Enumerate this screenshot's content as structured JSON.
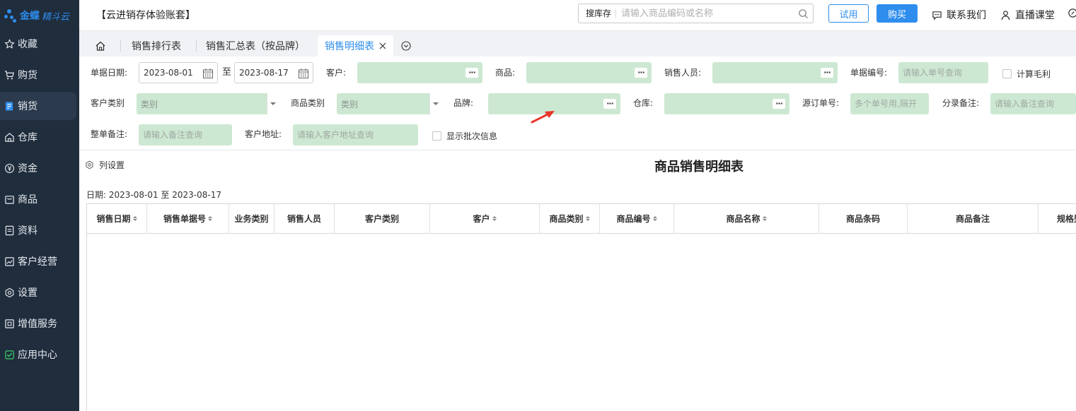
{
  "sidebar": {
    "logo_brand": "金蝶",
    "logo_sub": "精斗云",
    "items": [
      {
        "label": "收藏",
        "icon": "star-icon"
      },
      {
        "label": "购货",
        "icon": "cart-icon"
      },
      {
        "label": "销货",
        "icon": "sales-doc-icon"
      },
      {
        "label": "仓库",
        "icon": "warehouse-icon"
      },
      {
        "label": "资金",
        "icon": "yen-icon"
      },
      {
        "label": "商品",
        "icon": "product-icon"
      },
      {
        "label": "资料",
        "icon": "file-icon"
      },
      {
        "label": "客户经营",
        "icon": "chart-icon"
      },
      {
        "label": "设置",
        "icon": "settings-icon"
      },
      {
        "label": "增值服务",
        "icon": "service-icon"
      },
      {
        "label": "应用中心",
        "icon": "app-check-icon"
      }
    ],
    "active_index": 2
  },
  "header": {
    "account": "【云进销存体验账套】",
    "search_scope": "搜库存",
    "search_placeholder": "请输入商品编码或名称",
    "trial_label": "试用",
    "buy_label": "购买",
    "contact_label": "联系我们",
    "live_label": "直播课堂"
  },
  "tabs": {
    "items": [
      "销售排行表",
      "销售汇总表（按品牌）",
      "销售明细表"
    ],
    "active_index": 2
  },
  "filters": {
    "doc_date_label": "单据日期:",
    "date_from": "2023-08-01",
    "date_to_sep": "至",
    "date_to": "2023-08-17",
    "customer_label": "客户:",
    "product_label": "商品:",
    "salesperson_label": "销售人员:",
    "doc_no_label": "单据编号:",
    "doc_no_placeholder": "请输入单号查询",
    "gross_profit_label": "计算毛利",
    "customer_cat_label": "客户类别",
    "customer_cat_value": "类别",
    "product_cat_label": "商品类别",
    "product_cat_value": "类别",
    "brand_label": "品牌:",
    "warehouse_label": "仓库:",
    "source_order_label": "源订单号:",
    "source_order_placeholder": "多个单号用,隔开",
    "entry_note_label": "分录备注:",
    "entry_note_placeholder": "请输入备注查询",
    "whole_note_label": "整单备注:",
    "whole_note_placeholder": "请输入备注查询",
    "address_label": "客户地址:",
    "address_placeholder": "请输入客户地址查询",
    "batch_label": "显示批次信息"
  },
  "report": {
    "column_settings": "列设置",
    "title": "商品销售明细表",
    "date_range": "日期: 2023-08-01 至 2023-08-17",
    "columns": [
      {
        "label": "销售日期",
        "sortable": true
      },
      {
        "label": "销售单据号",
        "sortable": true
      },
      {
        "label": "业务类别",
        "sortable": false
      },
      {
        "label": "销售人员",
        "sortable": false
      },
      {
        "label": "客户类别",
        "sortable": false
      },
      {
        "label": "客户",
        "sortable": true
      },
      {
        "label": "商品类别",
        "sortable": true
      },
      {
        "label": "商品编号",
        "sortable": true
      },
      {
        "label": "商品名称",
        "sortable": true
      },
      {
        "label": "商品条码",
        "sortable": false
      },
      {
        "label": "商品备注",
        "sortable": false
      },
      {
        "label": "规格型号",
        "sortable": true
      }
    ]
  },
  "colors": {
    "sidebar_bg": "#1f2d3d",
    "accent": "#2e8ded",
    "filter_field_bg": "#cde8d2",
    "annotation_arrow": "#e8352a"
  }
}
